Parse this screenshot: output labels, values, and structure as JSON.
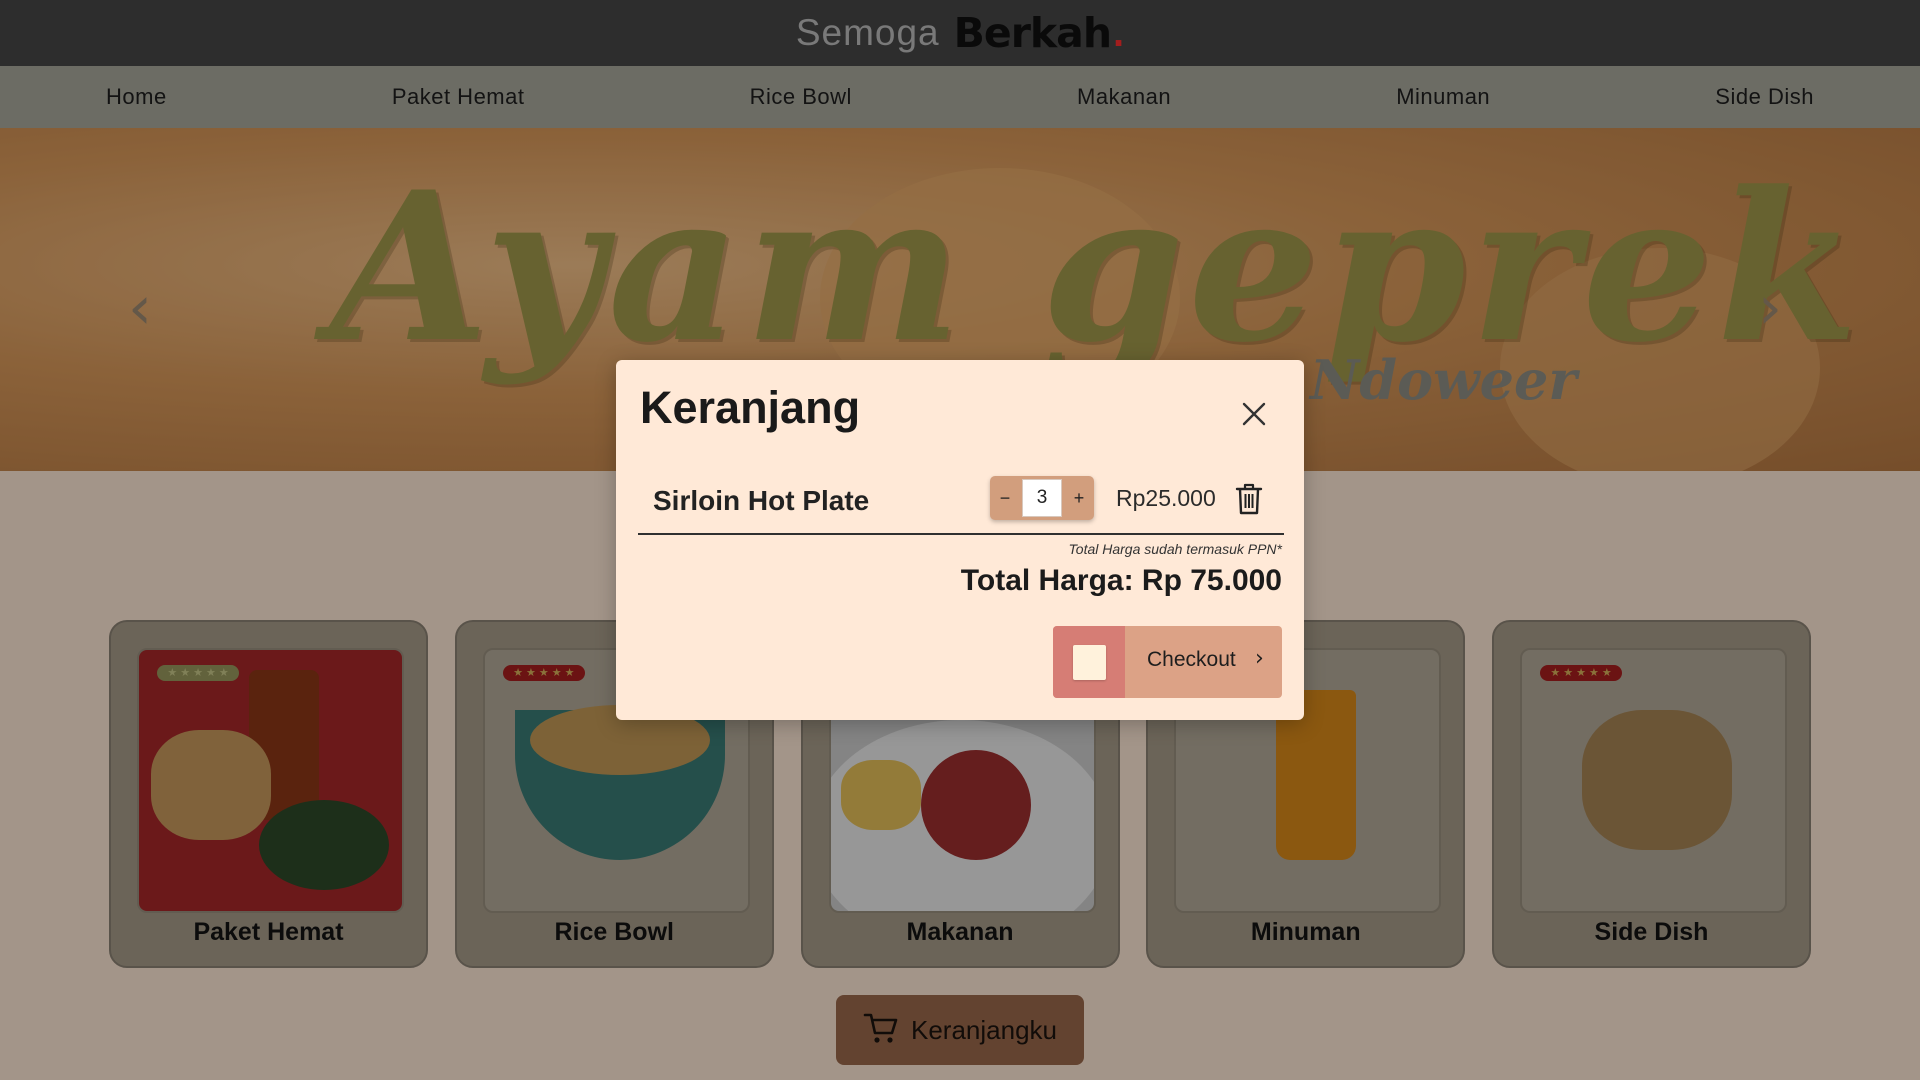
{
  "header": {
    "brand_light": "Semoga",
    "brand_bold": "Berkah",
    "brand_dot": "."
  },
  "nav": {
    "items": [
      "Home",
      "Paket Hemat",
      "Rice Bowl",
      "Makanan",
      "Minuman",
      "Side Dish"
    ]
  },
  "hero": {
    "title": "Ayam geprek",
    "subtitle": "Ndoweer",
    "prev_glyph": "‹",
    "next_glyph": "›"
  },
  "categories": [
    {
      "name": "Paket Hemat",
      "stars": 5
    },
    {
      "name": "Rice Bowl",
      "stars": 5
    },
    {
      "name": "Makanan",
      "stars": 5
    },
    {
      "name": "Minuman",
      "stars": 5
    },
    {
      "name": "Side Dish",
      "stars": 5
    }
  ],
  "cart_button": {
    "label": "Keranjangku",
    "icon": "cart-icon"
  },
  "modal": {
    "title": "Keranjang",
    "close_icon": "close-icon",
    "item": {
      "name": "Sirloin Hot Plate",
      "quantity": "3",
      "minus": "−",
      "plus": "+",
      "price": "Rp25.000",
      "delete_icon": "trash-icon"
    },
    "tax_note": "Total Harga sudah termasuk PPN*",
    "total": "Total Harga: Rp 75.000",
    "checkout": {
      "label": "Checkout",
      "chevron": "›"
    }
  },
  "colors": {
    "header_bg": "#474747",
    "nav_bg": "#a9a99d",
    "modal_bg": "#ffe9d7",
    "checkout_accent": "#d67d75",
    "cart_button_bg": "#9c6a4c"
  }
}
